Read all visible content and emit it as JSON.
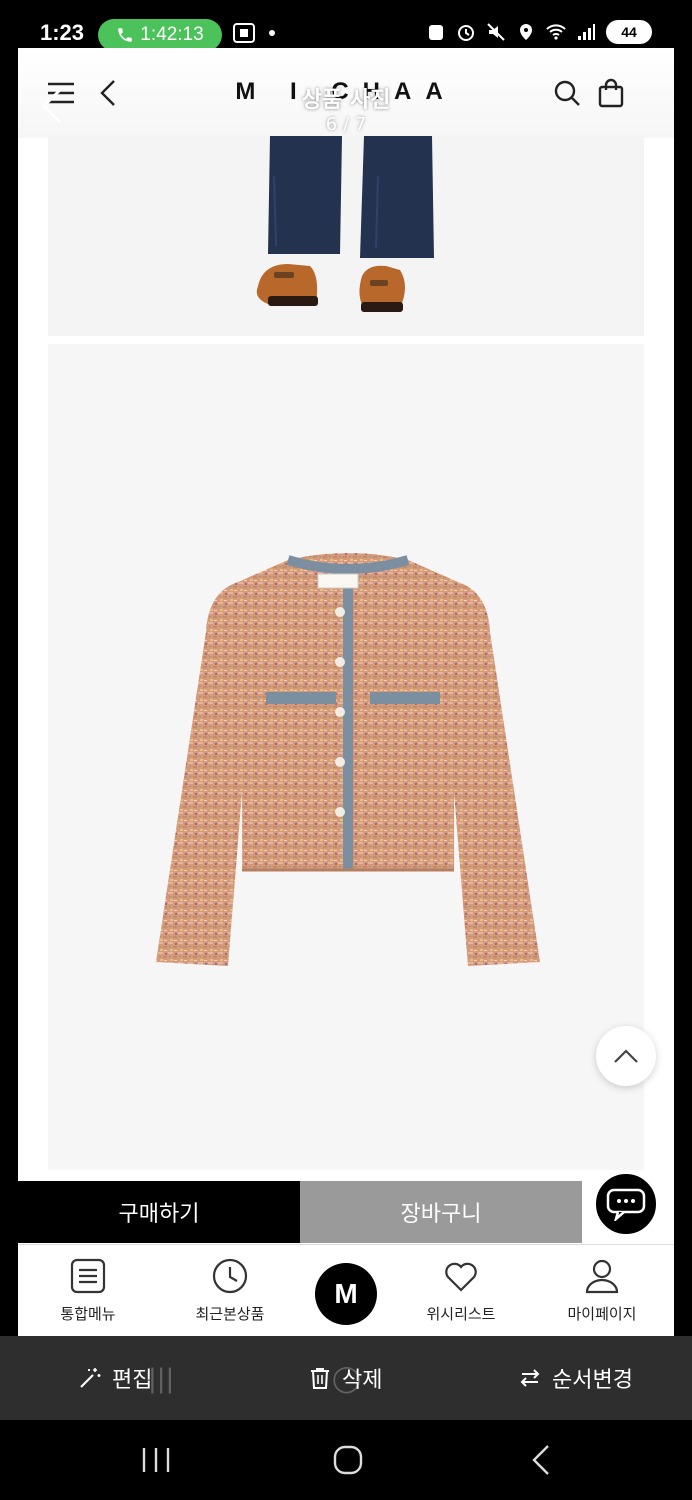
{
  "status": {
    "time": "1:23",
    "call_timer": "1:42:13",
    "battery": "44"
  },
  "header": {
    "brand": "M I CHAA",
    "viewer_title": "상품 사진",
    "viewer_count": "6 / 7"
  },
  "actions": {
    "buy_label": "구매하기",
    "cart_label": "장바구니"
  },
  "tabbar": {
    "items": [
      {
        "label": "통합메뉴",
        "icon": "menu-list-icon"
      },
      {
        "label": "최근본상품",
        "icon": "clock-icon"
      },
      {
        "label": "M",
        "icon": "home-logo"
      },
      {
        "label": "위시리스트",
        "icon": "heart-icon"
      },
      {
        "label": "마이페이지",
        "icon": "person-icon"
      }
    ]
  },
  "gallery_toolbar": {
    "edit_label": "편집",
    "delete_label": "삭제",
    "reorder_label": "순서변경"
  },
  "colors": {
    "call_green": "#4cc35a",
    "buy_black": "#000000",
    "cart_gray": "#9a9a9a",
    "toolbar_bg": "#2e2e2e"
  }
}
